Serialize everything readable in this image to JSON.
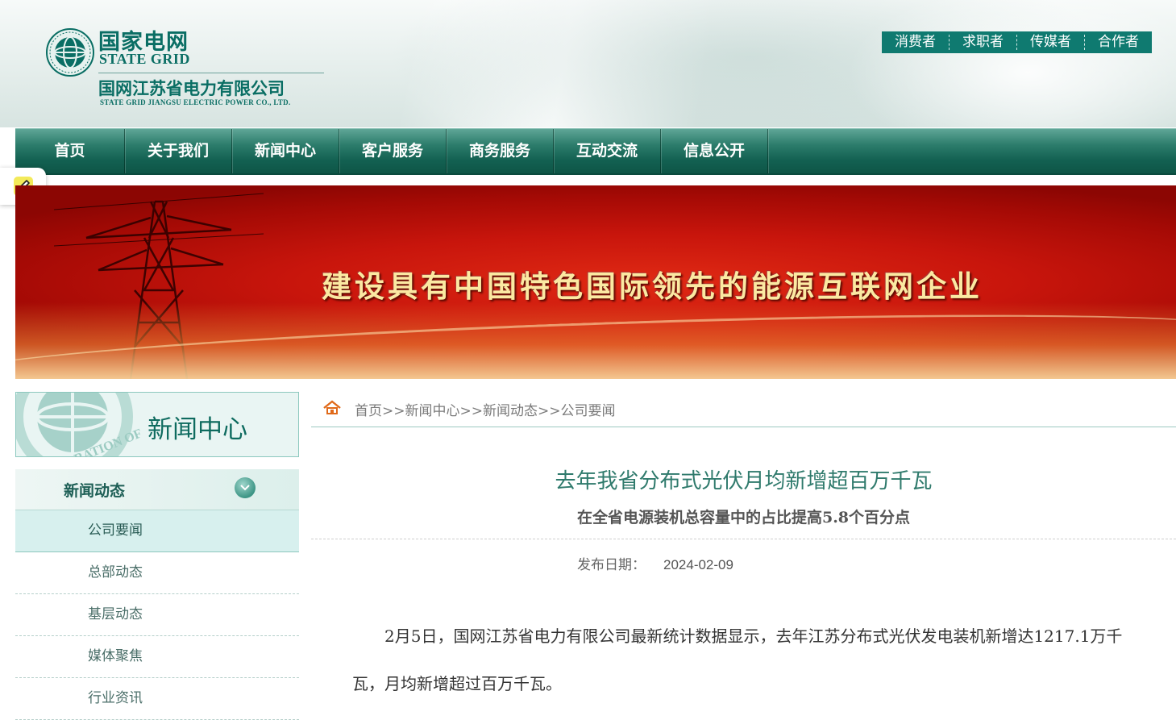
{
  "header": {
    "logo_cn": "国家电网",
    "logo_en": "STATE GRID",
    "company_cn": "国网江苏省电力有限公司",
    "company_en": "STATE GRID JIANGSU ELECTRIC POWER CO., LTD.",
    "top_links": [
      "消费者",
      "求职者",
      "传媒者",
      "合作者"
    ]
  },
  "nav": {
    "items": [
      "首页",
      "关于我们",
      "新闻中心",
      "客户服务",
      "商务服务",
      "互动交流",
      "信息公开"
    ]
  },
  "banner": {
    "slogan": "建设具有中国特色国际领先的能源互联网企业"
  },
  "sidebar": {
    "title": "新闻中心",
    "seal_text": "CORPORATION OF",
    "section": "新闻动态",
    "items": [
      "公司要闻",
      "总部动态",
      "基层动态",
      "媒体聚焦",
      "行业资讯"
    ],
    "active_index": 0
  },
  "breadcrumb": {
    "path": "首页>>新闻中心>>新闻动态>>公司要闻"
  },
  "article": {
    "title": "去年我省分布式光伏月均新增超百万千瓦",
    "subtitle": "在全省电源装机总容量中的占比提高5.8个百分点",
    "date_label": "发布日期：",
    "date": "2024-02-09",
    "paragraph": "2月5日，国网江苏省电力有限公司最新统计数据显示，去年江苏分布式光伏发电装机新增达1217.1万千瓦，月均新增超过百万千瓦。"
  },
  "colors": {
    "brand_green": "#0a6e64",
    "nav_green": "#136152",
    "banner_red": "#c8150c",
    "title_green": "#2f7a6c"
  }
}
